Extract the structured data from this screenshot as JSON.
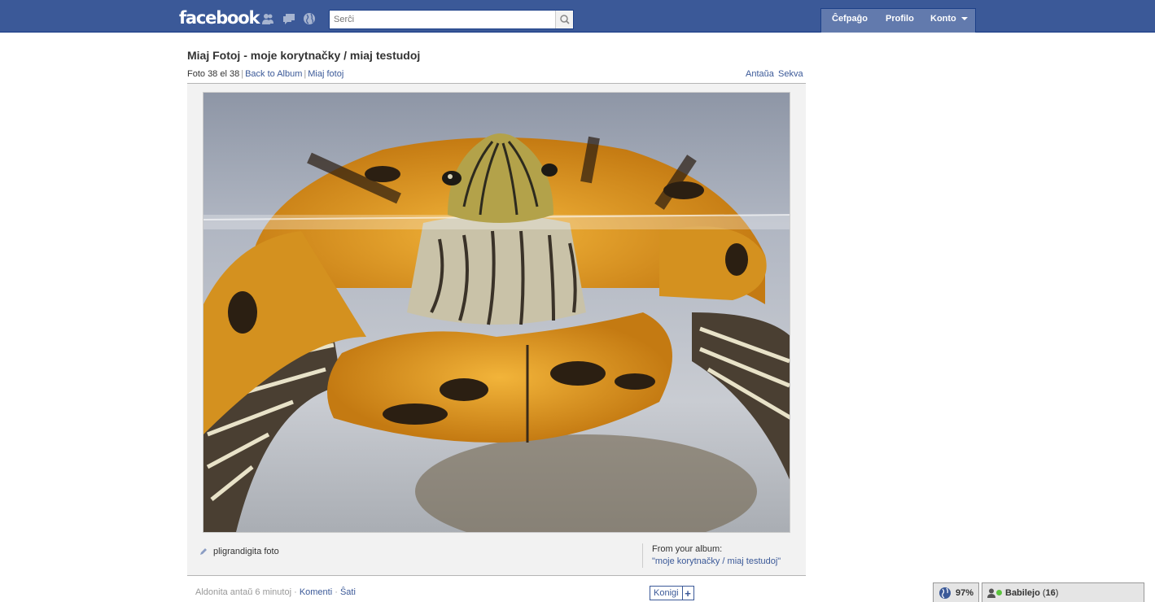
{
  "header": {
    "logo": "facebook",
    "search_placeholder": "Serĉi",
    "nav": {
      "home": "Ĉefpaĝo",
      "profile": "Profilo",
      "account": "Konto"
    }
  },
  "page": {
    "title": "Miaj Fotoj - moje korytnačky / miaj testudoj",
    "photo_position": "Foto 38 el 38",
    "back_to_album": "Back to Album",
    "my_photos": "Miaj fotoj",
    "previous": "Antaŭa",
    "next": "Sekva"
  },
  "photo": {
    "enlarge_label": "pligrandigita foto",
    "album_label": "From your album:",
    "album_name": "\"moje korytnačky / miaj testudoj\""
  },
  "footer": {
    "added": "Aldonita antaŭ 6 minutoj",
    "comment": "Komenti",
    "like": "Ŝati",
    "like_button": "Konigi",
    "plus": "+"
  },
  "chat": {
    "applications_pct": "97%",
    "chat_label": "Babilejo",
    "online_count": "16"
  },
  "colors": {
    "brand": "#3b5998",
    "nav": "#627aad",
    "online": "#5ac43c"
  }
}
